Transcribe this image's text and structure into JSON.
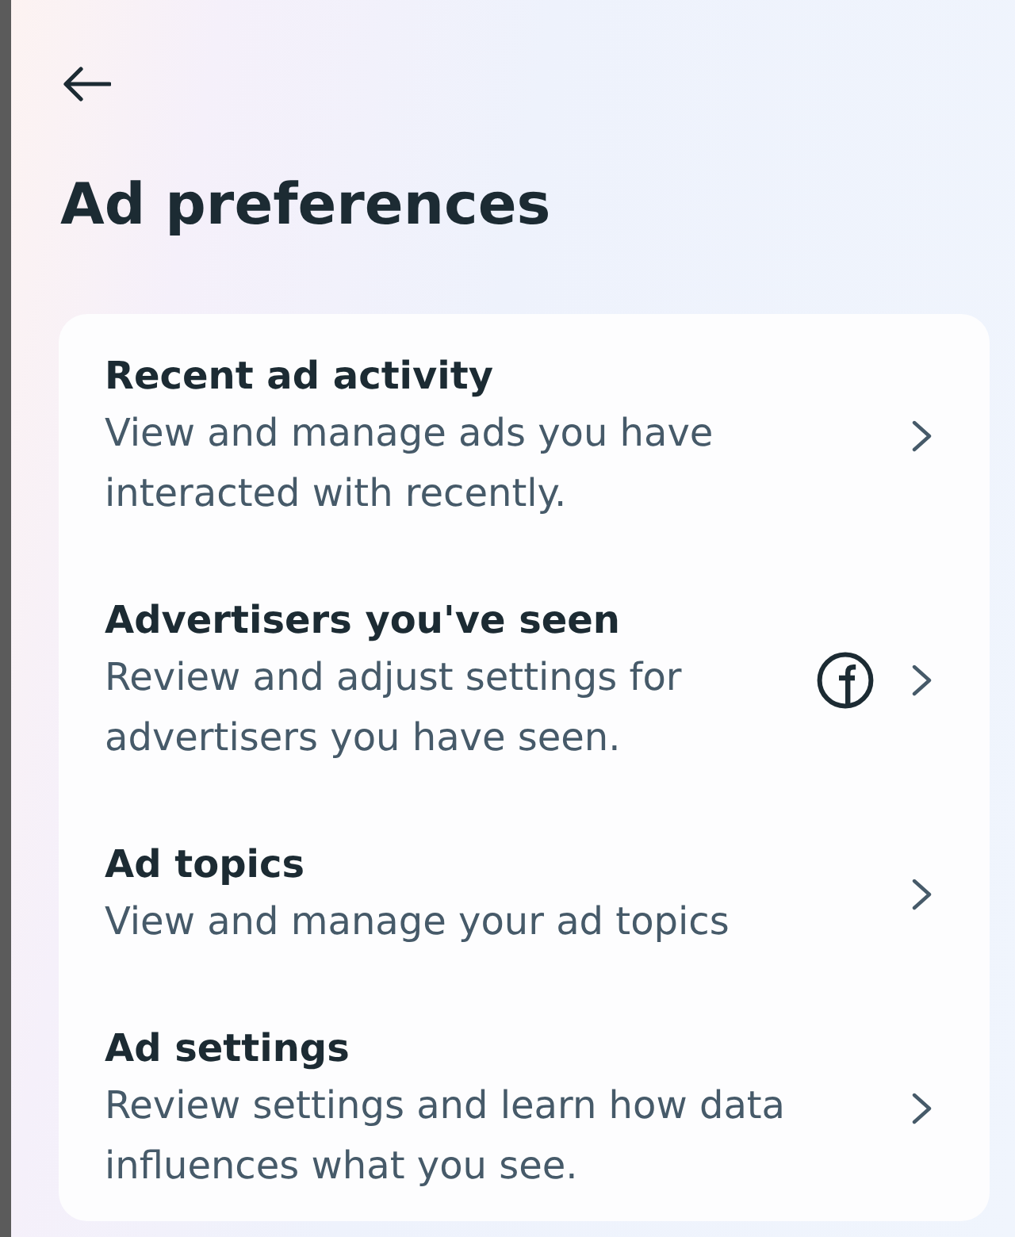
{
  "header": {
    "title": "Ad preferences"
  },
  "items": [
    {
      "kind": "plain",
      "title": "Recent ad activity",
      "description": "View and manage ads you have interacted with recently."
    },
    {
      "kind": "logo",
      "title": "Advertisers you've seen",
      "description": "Review and adjust settings for advertisers you have seen."
    },
    {
      "kind": "plain",
      "title": "Ad topics",
      "description": "View and manage your ad topics"
    },
    {
      "kind": "plain",
      "title": "Ad settings",
      "description": "Review settings and learn how data influences what you see."
    }
  ]
}
